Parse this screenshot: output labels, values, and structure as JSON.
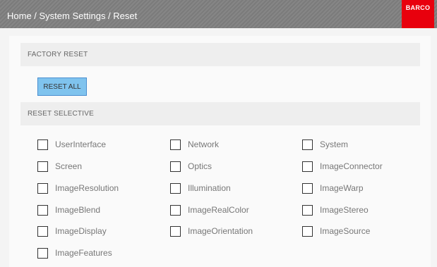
{
  "header": {
    "breadcrumb": "Home / System Settings / Reset",
    "logo_text": "BARCO"
  },
  "factory_reset": {
    "title": "FACTORY RESET",
    "button_label": "RESET ALL"
  },
  "reset_selective": {
    "title": "RESET SELECTIVE",
    "options": [
      {
        "label": "UserInterface",
        "checked": false
      },
      {
        "label": "Network",
        "checked": false
      },
      {
        "label": "System",
        "checked": false
      },
      {
        "label": "Screen",
        "checked": false
      },
      {
        "label": "Optics",
        "checked": false
      },
      {
        "label": "ImageConnector",
        "checked": false
      },
      {
        "label": "ImageResolution",
        "checked": false
      },
      {
        "label": "Illumination",
        "checked": false
      },
      {
        "label": "ImageWarp",
        "checked": false
      },
      {
        "label": "ImageBlend",
        "checked": false
      },
      {
        "label": "ImageRealColor",
        "checked": false
      },
      {
        "label": "ImageStereo",
        "checked": false
      },
      {
        "label": "ImageDisplay",
        "checked": false
      },
      {
        "label": "ImageOrientation",
        "checked": false
      },
      {
        "label": "ImageSource",
        "checked": false
      },
      {
        "label": "ImageFeatures",
        "checked": false
      }
    ]
  },
  "colors": {
    "topbar": "#808080",
    "logo": "#e8000d",
    "button": "#7fc3ee"
  }
}
